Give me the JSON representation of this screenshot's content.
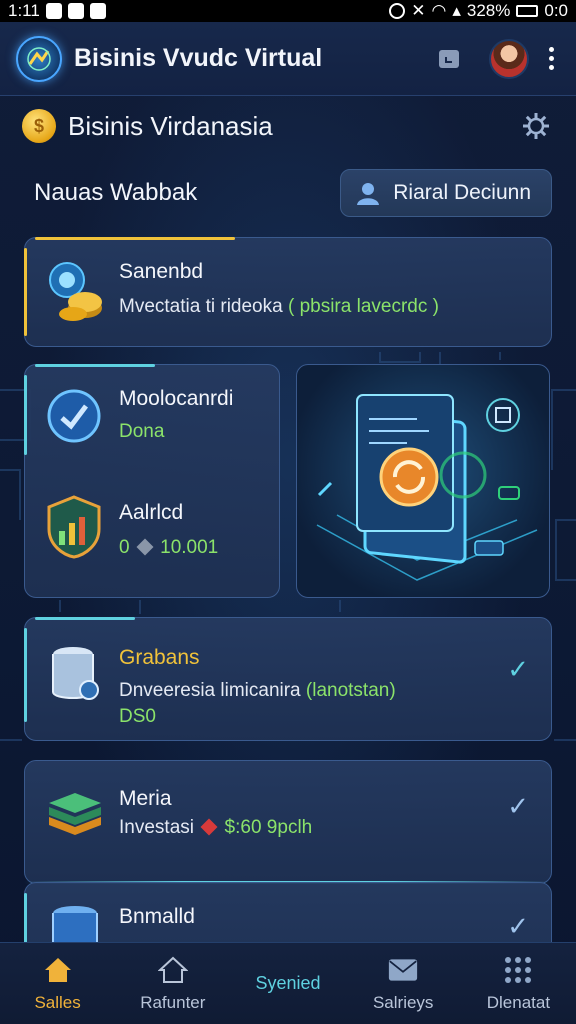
{
  "status_bar": {
    "time": "1:11",
    "battery_percent": "328%",
    "clock_right": "0:0"
  },
  "app": {
    "title": "Bisinis Vvudc Virtual"
  },
  "section": {
    "title": "Bisinis Virdanasia"
  },
  "row": {
    "label": "Nauas Wabbak",
    "button_label": "Riaral Deciunn"
  },
  "cards": [
    {
      "title": "Sanenbd",
      "subtitle": "Mvectatia ti rideoka",
      "highlight": "( pbsira lavecrdc )"
    },
    {
      "title": "Moolocanrdi",
      "value": "Dona"
    },
    {
      "title": "Aalrlcd",
      "value_prefix": "0",
      "value": "10.001"
    },
    {
      "title": "Grabans",
      "subtitle": "Dnveeresia limicanira",
      "highlight": "(lanotstan)",
      "value": "DS0"
    },
    {
      "title": "Meria",
      "subtitle": "Investasi",
      "highlight": "$:60 9pclh"
    },
    {
      "title": "Bnmalld"
    }
  ],
  "bottom_nav": [
    {
      "label": "Salles",
      "icon": "home-icon"
    },
    {
      "label": "Rafunter",
      "icon": "house-outline-icon"
    },
    {
      "label": "Syenied",
      "icon": ""
    },
    {
      "label": "Salrieys",
      "icon": "mail-icon"
    },
    {
      "label": "Dlenatat",
      "icon": "grid-icon"
    }
  ],
  "colors": {
    "accent_yellow": "#f0c23a",
    "accent_cyan": "#5fd1e0",
    "accent_green": "#8be36a",
    "background": "#0f1a34"
  }
}
